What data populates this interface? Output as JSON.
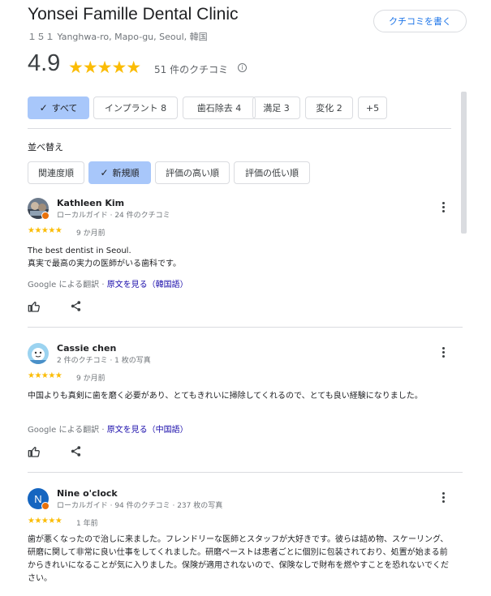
{
  "header": {
    "title": "Yonsei Famille Dental Clinic",
    "address": "１５１ Yanghwa-ro, Mapo-gu, Seoul, 韓国",
    "write_review": "クチコミを書く"
  },
  "summary": {
    "rating": "4.9",
    "stars": "★★★★★",
    "review_count": "51 件のクチコミ",
    "info_icon": "info-icon"
  },
  "filters": [
    {
      "label": "すべて",
      "active": true
    },
    {
      "label": "インプラント  8",
      "active": false
    },
    {
      "label": "歯石除去  4",
      "active": false
    },
    {
      "label": "満足  3",
      "active": false
    },
    {
      "label": "変化  2",
      "active": false
    },
    {
      "label": "+5",
      "active": false
    }
  ],
  "sort": {
    "label": "並べ替え",
    "options": [
      {
        "label": "関連度順",
        "active": false
      },
      {
        "label": "新規順",
        "active": true
      },
      {
        "label": "評価の高い順",
        "active": false
      },
      {
        "label": "評価の低い順",
        "active": false
      }
    ]
  },
  "reviews": [
    {
      "name": "Kathleen Kim",
      "meta": "ローカルガイド · 24 件のクチコミ",
      "stars": "★★★★★",
      "when": "9 か月前",
      "text_line1": "The best dentist in Seoul.",
      "text_line2": "真実で最高の実力の医師がいる歯科です。",
      "translate_prefix": "Google による翻訳 · ",
      "translate_link": "原文を見る（韓国語）"
    },
    {
      "name": "Cassie chen",
      "meta": "2 件のクチコミ · 1 枚の写真",
      "stars": "★★★★★",
      "when": "9 か月前",
      "text": "中国よりも真剣に歯を磨く必要があり、とてもきれいに掃除してくれるので、とても良い経験になりました。",
      "translate_prefix": "Google による翻訳 · ",
      "translate_link": "原文を見る（中国語）"
    },
    {
      "name": "Nine o'clock",
      "initial": "N",
      "meta": "ローカルガイド · 94 件のクチコミ · 237 枚の写真",
      "stars": "★★★★★",
      "when": "1 年前",
      "text": "歯が悪くなったので治しに来ました。フレンドリーな医師とスタッフが大好きです。彼らは詰め物、スケーリング、研磨に関して非常に良い仕事をしてくれました。研磨ペーストは患者ごとに個別に包装されており、処置が始まる前からきれいになることが気に入りました。保険が適用されないので、保険なしで財布を燃やすことを恐れないでください。"
    }
  ],
  "colors": {
    "accent": "#1a73e8",
    "chip_active": "#a8c7fa",
    "star": "#fbbc04",
    "guide_badge": "#e8710a"
  }
}
